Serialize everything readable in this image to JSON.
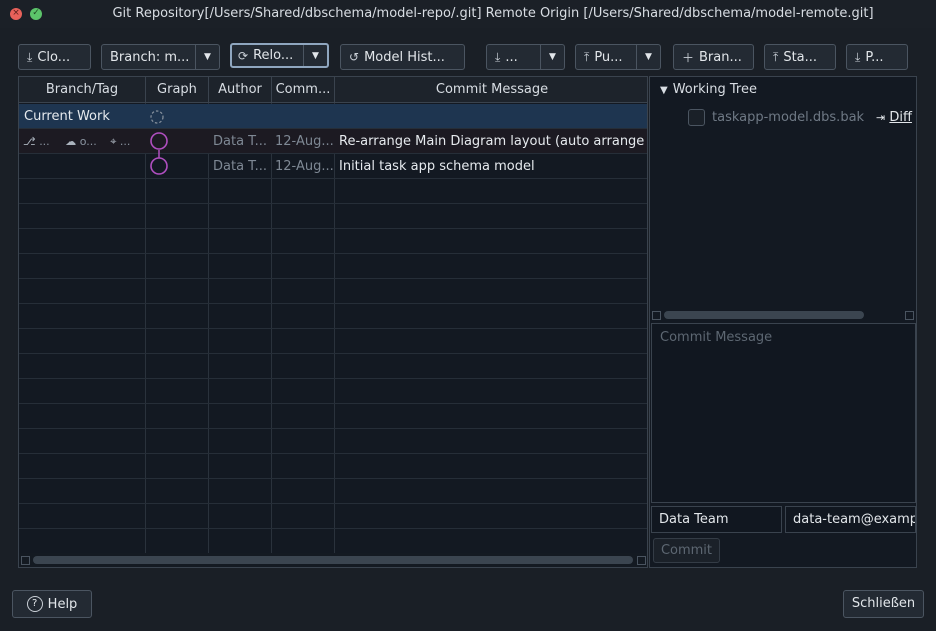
{
  "window": {
    "title": "Git Repository[/Users/Shared/dbschema/model-repo/.git] Remote Origin [/Users/Shared/dbschema/model-remote.git]",
    "close_glyph": "×",
    "zoom_glyph": "✓"
  },
  "toolbar": {
    "clone_label": "Clo...",
    "branch_label": "Branch: m...",
    "reload_label": "Relo...",
    "history_label": "Model Hist...",
    "fetch_label": "...",
    "push_label": "Pu...",
    "new_branch_label": "Bran...",
    "stash_label": "Sta...",
    "pull_label": "P..."
  },
  "table": {
    "columns": [
      "Branch/Tag",
      "Graph",
      "Author",
      "Comm...",
      "Commit Message"
    ],
    "current_work_label": "Current Work",
    "rows": [
      {
        "branch_tags": [
          "...",
          "o...",
          "..."
        ],
        "author": "Data T...",
        "date": "12-Aug...",
        "message": "Re-arrange Main Diagram layout (auto arrange)"
      },
      {
        "author": "Data T...",
        "date": "12-Aug...",
        "message": "Initial task app schema model"
      }
    ]
  },
  "right_panel": {
    "tree_label": "Working Tree",
    "file_name": "taskapp-model.dbs.bak",
    "diff_label": "Diff",
    "commit_placeholder": "Commit Message",
    "author_name": "Data Team",
    "author_email": "data-team@examp",
    "commit_button": "Commit"
  },
  "footer": {
    "help_label": "Help",
    "close_label": "Schließen"
  },
  "colors": {
    "graph_node": "#b04fc0",
    "selected_row": "#1e3550",
    "background": "#131922"
  }
}
